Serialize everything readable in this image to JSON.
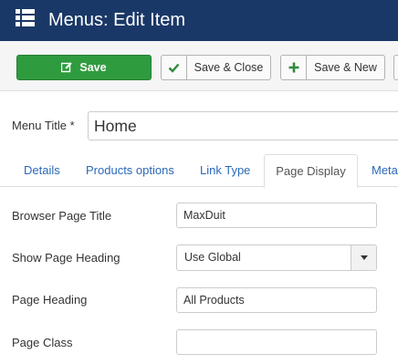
{
  "header": {
    "title": "Menus: Edit Item"
  },
  "toolbar": {
    "save_label": "Save",
    "save_close_label": "Save & Close",
    "save_new_label": "Save & New"
  },
  "form": {
    "menu_title_label": "Menu Title *",
    "menu_title_value": "Home"
  },
  "tabs": [
    {
      "label": "Details"
    },
    {
      "label": "Products options"
    },
    {
      "label": "Link Type"
    },
    {
      "label": "Page Display"
    },
    {
      "label": "Meta"
    }
  ],
  "active_tab": "Page Display",
  "fields": {
    "browser_page_title": {
      "label": "Browser Page Title",
      "value": "MaxDuit"
    },
    "show_page_heading": {
      "label": "Show Page Heading",
      "value": "Use Global"
    },
    "page_heading": {
      "label": "Page Heading",
      "value": "All Products"
    },
    "page_class": {
      "label": "Page Class",
      "value": ""
    }
  },
  "colors": {
    "header_bg": "#1a3867",
    "save_green": "#2f9b3f",
    "link_blue": "#2a69b8"
  },
  "icons": {
    "header": "list-menu-icon",
    "save": "edit-icon",
    "save_close": "check-icon",
    "save_new": "plus-icon",
    "select": "caret-down-icon"
  }
}
